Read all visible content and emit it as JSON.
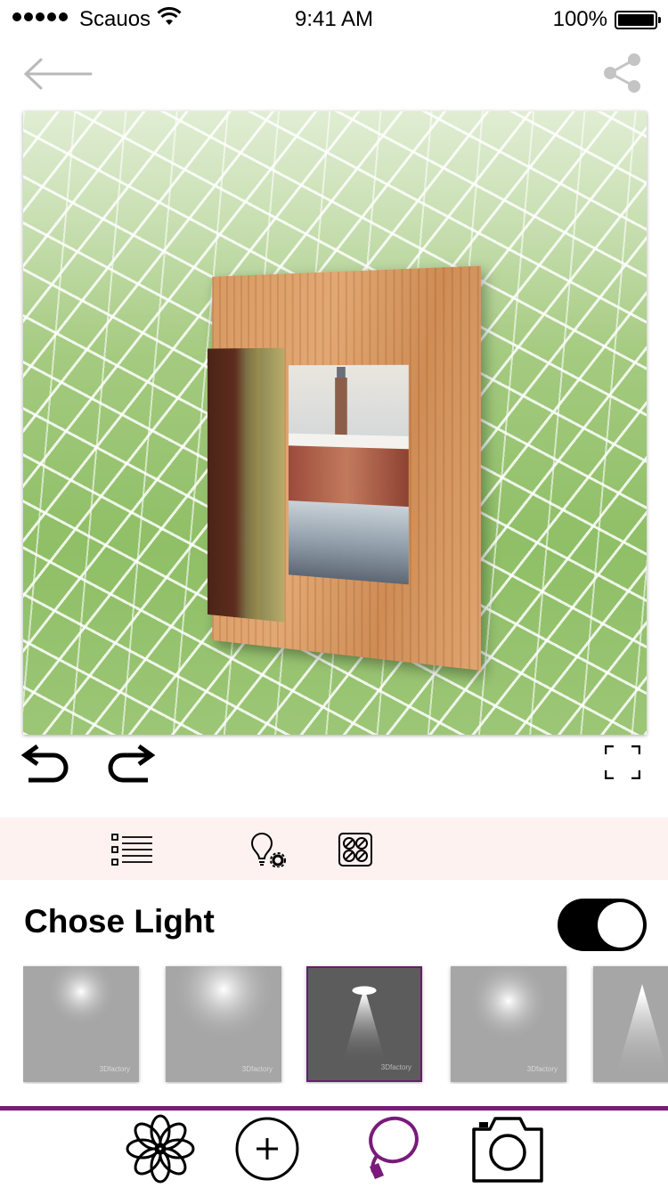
{
  "status_bar": {
    "carrier": "Scauos",
    "time": "9:41 AM",
    "battery": "100%",
    "battery_level": 1.0
  },
  "nav": {
    "back_icon": "arrow-left-icon",
    "share_icon": "share-icon"
  },
  "preview": {
    "scene": "picture-frame-on-stone-floor"
  },
  "edit_controls": {
    "undo_icon": "undo-icon",
    "redo_icon": "redo-icon",
    "fullscreen_icon": "fullscreen-icon"
  },
  "tools": [
    {
      "name": "list-icon"
    },
    {
      "name": "lightbulb-settings-icon"
    },
    {
      "name": "texture-grid-icon"
    }
  ],
  "light_section": {
    "title": "Chose Light",
    "toggle_on": true,
    "selected_index": 2,
    "thumb_caption": "3Dfactory"
  },
  "tab_bar": {
    "accent_color": "#7a1a7c",
    "tabs": [
      {
        "name": "flower-icon"
      },
      {
        "name": "add-circle-icon"
      },
      {
        "name": "lasso-icon"
      },
      {
        "name": "camera-icon"
      }
    ]
  }
}
